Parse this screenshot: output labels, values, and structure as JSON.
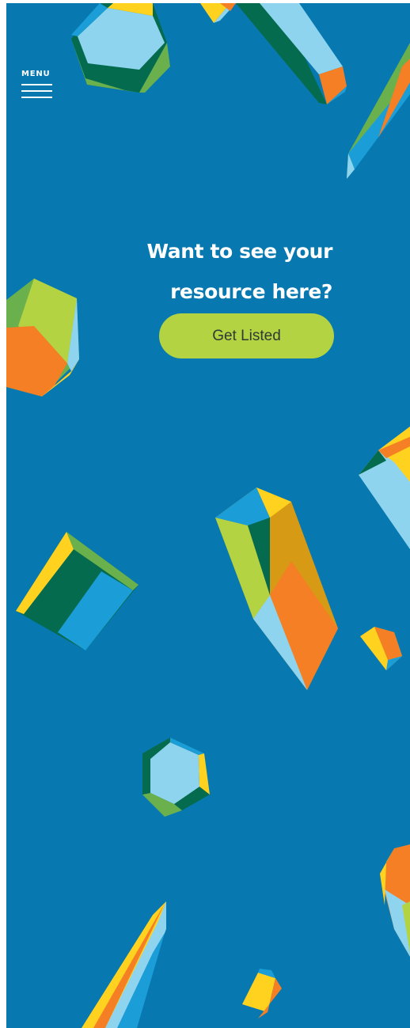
{
  "header": {
    "menu_label": "MENU"
  },
  "cta": {
    "heading_line1": "Want to see your",
    "heading_line2": "resource here?",
    "button_label": "Get Listed"
  },
  "colors": {
    "background": "#0779b0",
    "button": "#b3d342",
    "light_blue": "#8fd4ef",
    "blue": "#1b9dd8",
    "dark_green": "#056b4f",
    "green": "#6ab04c",
    "lime": "#b3d342",
    "orange": "#f47f24",
    "yellow": "#ffd21f"
  },
  "icons": {
    "menu": "hamburger-icon"
  }
}
